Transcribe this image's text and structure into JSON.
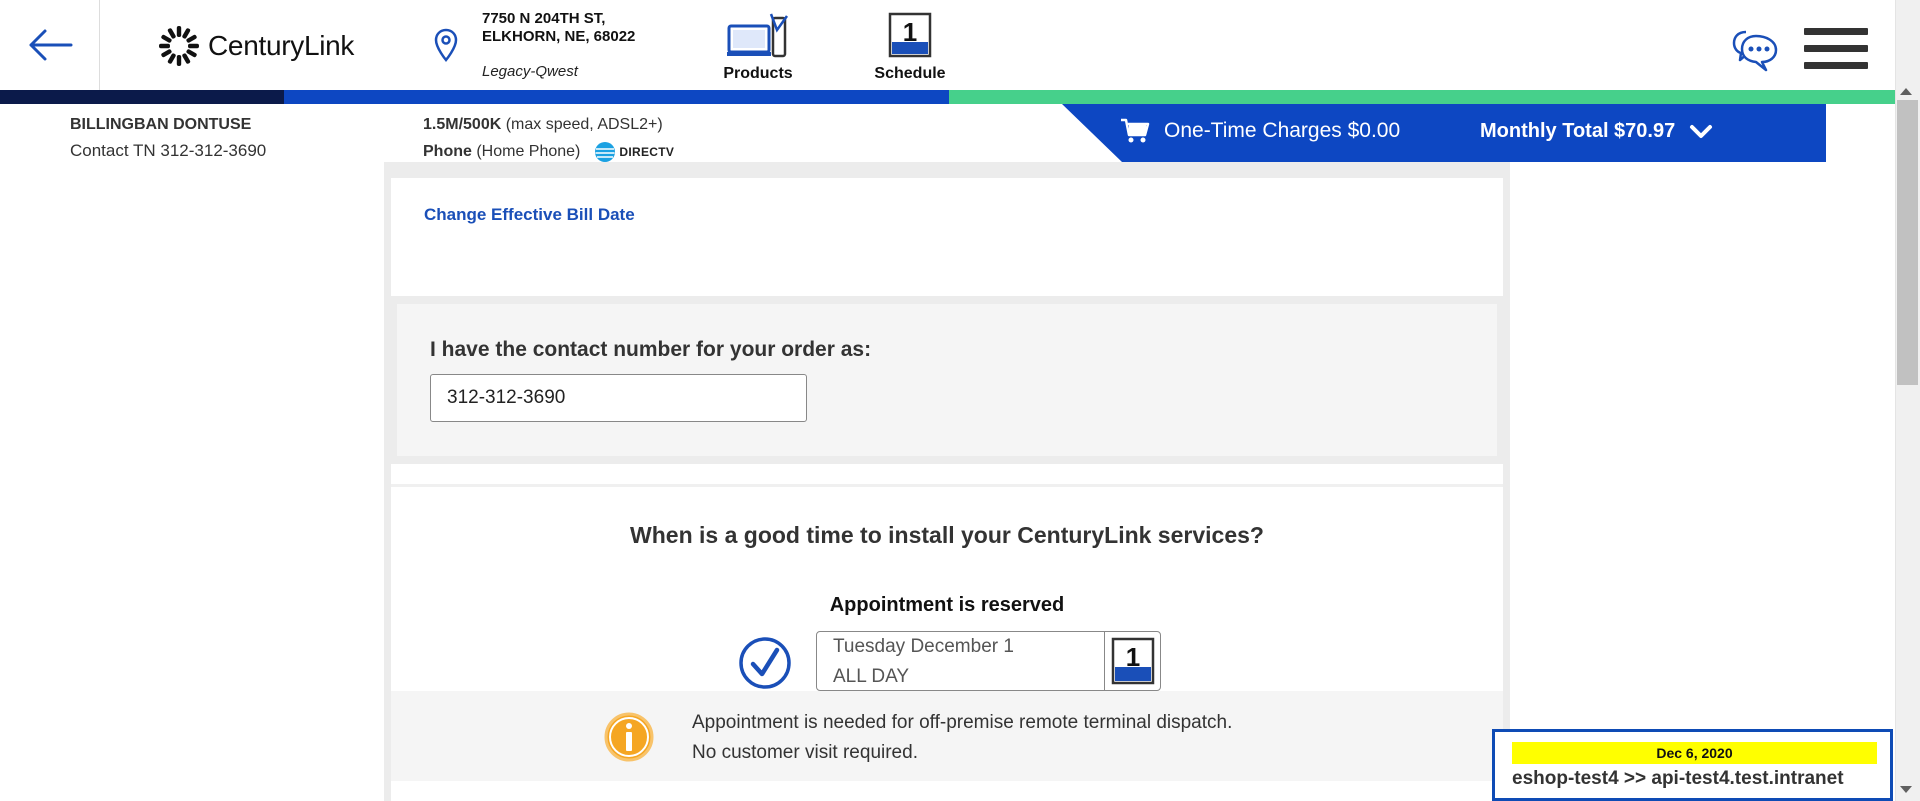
{
  "header": {
    "logo_brand": "CenturyLink",
    "address_line1": "7750 N 204TH ST,",
    "address_line2": "ELKHORN, NE, 68022",
    "legacy": "Legacy-Qwest",
    "nav_products": "Products",
    "nav_schedule": "Schedule",
    "calendar_day": "1"
  },
  "progress_colors": [
    "#0b1a4a",
    "#0d47c2",
    "#46d08b"
  ],
  "customer": {
    "name": "BILLINGBAN DONTUSE",
    "contact_tn": "Contact TN 312-312-3690"
  },
  "service": {
    "speed_bold": "1.5M/500K",
    "speed_rest": " (max speed, ADSL2+)",
    "phone_bold": "Phone",
    "phone_rest": " (Home Phone)",
    "partner_logo": "DIRECTV"
  },
  "charges": {
    "one_time": "One-Time Charges $0.00",
    "monthly": "Monthly Total $70.97"
  },
  "bill": {
    "change_link": "Change Effective Bill Date"
  },
  "contact": {
    "label": "I have the contact number for your order as:",
    "value": "312-312-3690"
  },
  "install": {
    "question": "When is a good time to install your CenturyLink services?",
    "appointment_label": "Appointment is reserved",
    "date": "Tuesday December 1",
    "time": "ALL DAY",
    "notice_line1": "Appointment is needed for off-premise remote terminal dispatch.",
    "notice_line2": "No customer visit required."
  },
  "environment": {
    "date": "Dec 6, 2020",
    "label": "eshop-test4 >> api-test4.test.intranet"
  },
  "colors": {
    "brand_blue": "#0d47c2",
    "link_blue": "#1a4fb8",
    "warning_orange": "#f5a623",
    "env_highlight": "#ffff00"
  }
}
